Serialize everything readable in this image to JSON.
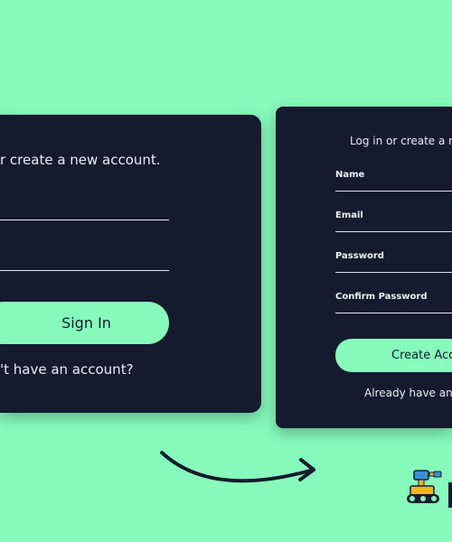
{
  "left_card": {
    "subtitle": "r create a new account.",
    "button_label": "Sign In",
    "question": "'t have an account?"
  },
  "right_card": {
    "subtitle": "Log in or create a n",
    "fields": [
      {
        "label": "Name"
      },
      {
        "label": "Email"
      },
      {
        "label": "Password"
      },
      {
        "label": "Confirm Password"
      }
    ],
    "button_label": "Create Acc",
    "question": "Already have an"
  },
  "colors": {
    "background": "#86fbbc",
    "card": "#141b2e",
    "accent": "#86fbbc",
    "text": "#e8edf3"
  },
  "decorations": {
    "arrow": "curved-arrow-icon",
    "logo": "robot-logo-icon"
  }
}
